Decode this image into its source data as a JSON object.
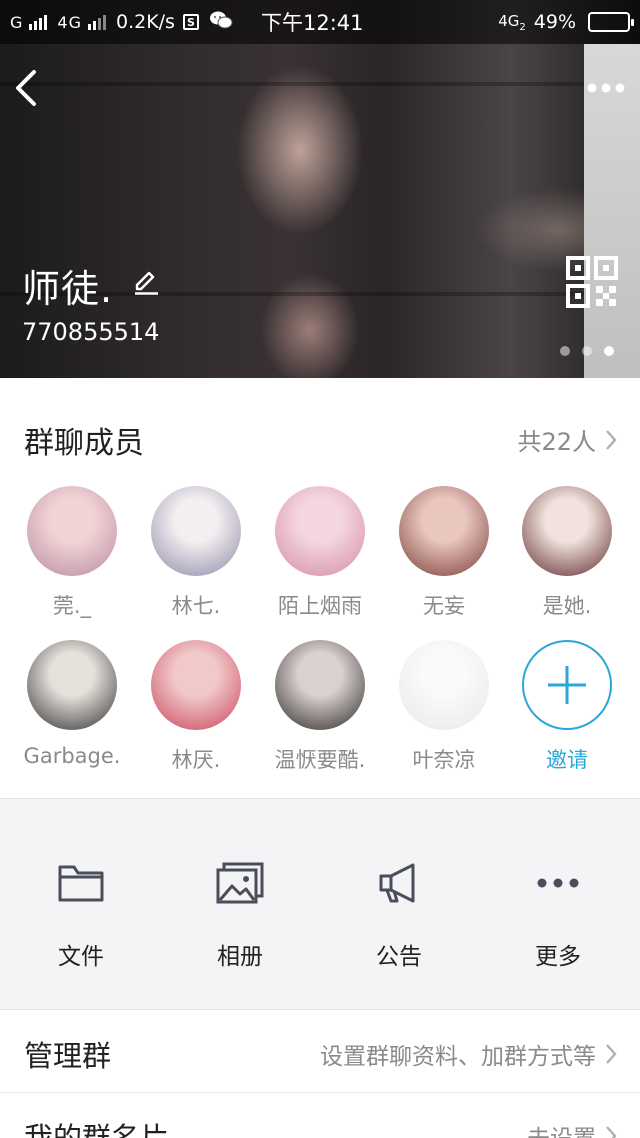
{
  "status_bar": {
    "carrier": "G",
    "network": "4G",
    "speed": "0.2K/s",
    "s_badge": "S",
    "wechat_icon": "wechat-icon",
    "time": "下午12:41",
    "network_right": "4G",
    "network_right_sub": "2",
    "battery": "49%"
  },
  "header": {
    "group_name": "师徒.",
    "group_id": "770855514",
    "pager_active_index": 2,
    "pager_count": 3
  },
  "members": {
    "title": "群聊成员",
    "count": "共22人",
    "list": [
      {
        "name": "莞._",
        "color_a": "#f1d3d6",
        "color_b": "#b88ca0"
      },
      {
        "name": "林七.",
        "color_a": "#f3eef0",
        "color_b": "#8e8aa8"
      },
      {
        "name": "陌上烟雨",
        "color_a": "#f4d6e0",
        "color_b": "#d58aa6"
      },
      {
        "name": "无妄",
        "color_a": "#e9c7bf",
        "color_b": "#7a3b37"
      },
      {
        "name": "是她.",
        "color_a": "#f2e2dd",
        "color_b": "#5b2a2e"
      },
      {
        "name": "Garbage.",
        "color_a": "#e7e1dc",
        "color_b": "#2f2f2f"
      },
      {
        "name": "林厌.",
        "color_a": "#f1c9c9",
        "color_b": "#c8445c"
      },
      {
        "name": "温恹要酷.",
        "color_a": "#d9d2cf",
        "color_b": "#2b2626"
      },
      {
        "name": "叶奈凉",
        "color_a": "#fafafa",
        "color_b": "#e8e8e8"
      }
    ],
    "invite_label": "邀请"
  },
  "functions": [
    {
      "label": "文件",
      "icon": "folder-icon"
    },
    {
      "label": "相册",
      "icon": "photo-album-icon"
    },
    {
      "label": "公告",
      "icon": "megaphone-icon"
    },
    {
      "label": "更多",
      "icon": "more-dots-icon"
    }
  ],
  "rows": {
    "manage": {
      "title": "管理群",
      "value": "设置群聊资料、加群方式等"
    },
    "card": {
      "title": "我的群名片",
      "value": "未设置"
    }
  },
  "colors": {
    "accent": "#2aa7d8",
    "secondary_text": "#8a8a8a",
    "primary_text": "#222222",
    "section_bg": "#f4f4f7"
  }
}
